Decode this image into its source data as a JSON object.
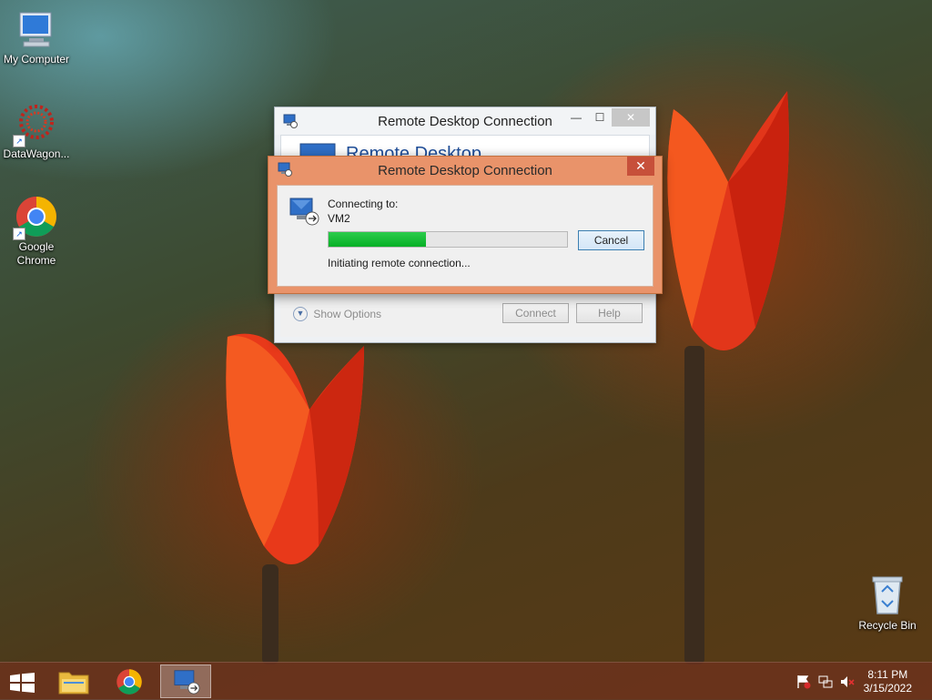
{
  "desktop": {
    "icons": [
      {
        "label": "My Computer",
        "icon": "computer-icon"
      },
      {
        "label": "DataWagon...",
        "icon": "datawagon-icon"
      },
      {
        "label": "Google Chrome",
        "icon": "chrome-icon"
      },
      {
        "label": "Recycle Bin",
        "icon": "recycle-bin-icon"
      }
    ]
  },
  "back_window": {
    "title": "Remote Desktop Connection",
    "banner_title": "Remote Desktop",
    "show_options": "Show Options",
    "connect_label": "Connect",
    "help_label": "Help"
  },
  "dialog": {
    "title": "Remote Desktop Connection",
    "connecting_to_label": "Connecting to:",
    "computer_name": "VM2",
    "cancel_label": "Cancel",
    "status": "Initiating remote connection...",
    "progress_fraction": 0.41,
    "accent_color": "#e9936a",
    "progress_color": "#06b025"
  },
  "taskbar": {
    "items": [
      {
        "icon": "windows-start-icon"
      },
      {
        "icon": "file-explorer-icon"
      },
      {
        "icon": "chrome-icon"
      },
      {
        "icon": "remote-desktop-icon",
        "active": true
      }
    ],
    "tray": [
      "action-center-flag-icon",
      "network-icon",
      "volume-muted-icon"
    ],
    "time": "8:11 PM",
    "date": "3/15/2022"
  }
}
